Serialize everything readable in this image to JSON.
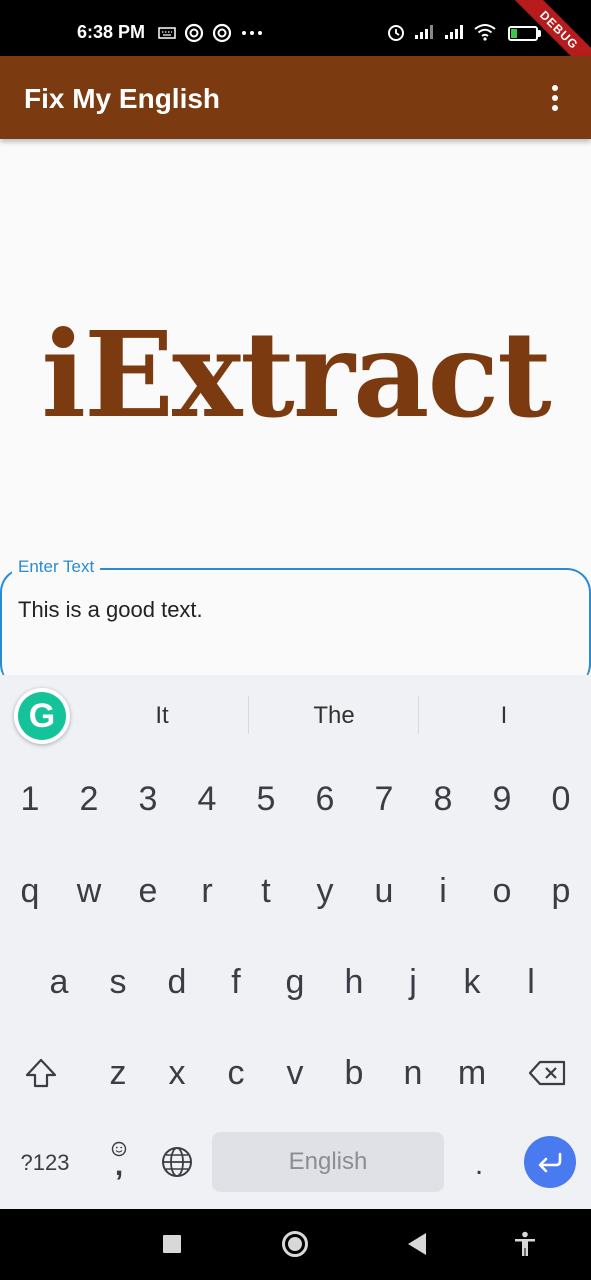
{
  "status_bar": {
    "time": "6:38 PM",
    "battery": "26",
    "battery_fraction": 0.26,
    "left_icons": [
      "keyboard-icon",
      "vpn-icon",
      "vpn-icon",
      "more-dots-icon"
    ],
    "right_icons": [
      "alarm-icon",
      "signal-icon",
      "signal-icon",
      "wifi-icon",
      "battery-icon"
    ]
  },
  "debug_banner": "DEBUG",
  "app_bar": {
    "title": "Fix My English",
    "menu_icon": "more-vert-icon"
  },
  "logo": {
    "text": "iExtract"
  },
  "text_field": {
    "label": "Enter Text",
    "value": "This is a good text."
  },
  "keyboard": {
    "suggestions": [
      "It",
      "The",
      "I"
    ],
    "row_numbers": [
      "1",
      "2",
      "3",
      "4",
      "5",
      "6",
      "7",
      "8",
      "9",
      "0"
    ],
    "row_top": [
      "q",
      "w",
      "e",
      "r",
      "t",
      "y",
      "u",
      "i",
      "o",
      "p"
    ],
    "row_mid": [
      "a",
      "s",
      "d",
      "f",
      "g",
      "h",
      "j",
      "k",
      "l"
    ],
    "row_bottom": [
      "z",
      "x",
      "c",
      "v",
      "b",
      "n",
      "m"
    ],
    "symbols_key": "?123",
    "comma_key": ",",
    "period_key": ".",
    "space_label": "English",
    "colors": {
      "accent": "#4a7af0",
      "grammarly": "#15c39a"
    }
  },
  "colors": {
    "brand": "#7b3a10",
    "field_accent": "#2b8ad6"
  },
  "nav_bar": {
    "icons": [
      "recents-icon",
      "home-icon",
      "back-icon",
      "accessibility-icon"
    ]
  }
}
